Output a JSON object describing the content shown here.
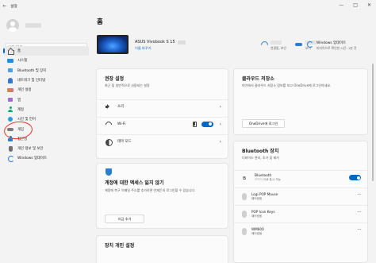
{
  "window": {
    "back_glyph": "←",
    "title": "설정",
    "minimize_glyph": "—",
    "maximize_glyph": "□",
    "close_glyph": "✕"
  },
  "sidebar": {
    "search_placeholder": "설정 검색",
    "search_glyph": "⌕",
    "items": [
      {
        "label": "홈",
        "icon": "home-icon",
        "active": true
      },
      {
        "label": "시스템",
        "icon": "system-icon"
      },
      {
        "label": "Bluetooth 및 장치",
        "icon": "bluetooth-devices-icon"
      },
      {
        "label": "네트워크 및 인터넷",
        "icon": "network-icon"
      },
      {
        "label": "개인 설정",
        "icon": "personalization-icon"
      },
      {
        "label": "앱",
        "icon": "apps-icon"
      },
      {
        "label": "계정",
        "icon": "accounts-icon"
      },
      {
        "label": "시간 및 언어",
        "icon": "time-language-icon"
      },
      {
        "label": "게임",
        "icon": "gaming-icon"
      },
      {
        "label": "접근성",
        "icon": "accessibility-icon"
      },
      {
        "label": "개인 정보 및 보안",
        "icon": "privacy-security-icon"
      },
      {
        "label": "Windows 업데이트",
        "icon": "windows-update-icon"
      }
    ],
    "highlight_color": "#e4342c"
  },
  "main": {
    "page_title": "홈",
    "device": {
      "name": "ASUS Vivobook S 15",
      "rename": "이름 바꾸기"
    },
    "status": {
      "wifi_sub": "연결됨, 보안",
      "cloud_sub": "보기",
      "update_title": "Windows 업데이트",
      "update_sub": "마지막으로 확인한 시간: 1분 전"
    },
    "recommended": {
      "title": "권장 설정",
      "subtitle": "최근 및 일반적으로 사용되는 설정",
      "rows": [
        {
          "label": "소리",
          "icon": "sound-icon"
        },
        {
          "label": "Wi-Fi",
          "icon": "wifi-icon",
          "toggle": true
        },
        {
          "label": "테마 모드",
          "icon": "theme-icon"
        }
      ]
    },
    "security_card": {
      "title": "계정에 대한 액세스 잃지 않기",
      "body": "계정에 복구 이메일 주소를 추가하면 언제든지 로그인할 수 있습니다.",
      "button": "지금 추가"
    },
    "device_customize": {
      "title": "장치 개인 설정"
    },
    "cloud": {
      "title": "클라우드 저장소",
      "body": "여기에서 클라우드 저장소 정보를 보고 OneDrive에 로그인하세요.",
      "button": "OneDrive에 로그인"
    },
    "bluetooth": {
      "title": "Bluetooth 장치",
      "subtitle": "디바이스 관리, 추가 및 제거",
      "bt_label": "Bluetooth",
      "bt_sub": "으로 표시 가능",
      "devices": [
        {
          "name": "Logi POP Mouse",
          "status": "페어링됨"
        },
        {
          "name": "POP Icon Keys",
          "status": "페어링됨"
        },
        {
          "name": "WM600",
          "status": "페어링됨"
        }
      ],
      "more_glyph": "···"
    }
  },
  "accent_color": "#0067c0"
}
